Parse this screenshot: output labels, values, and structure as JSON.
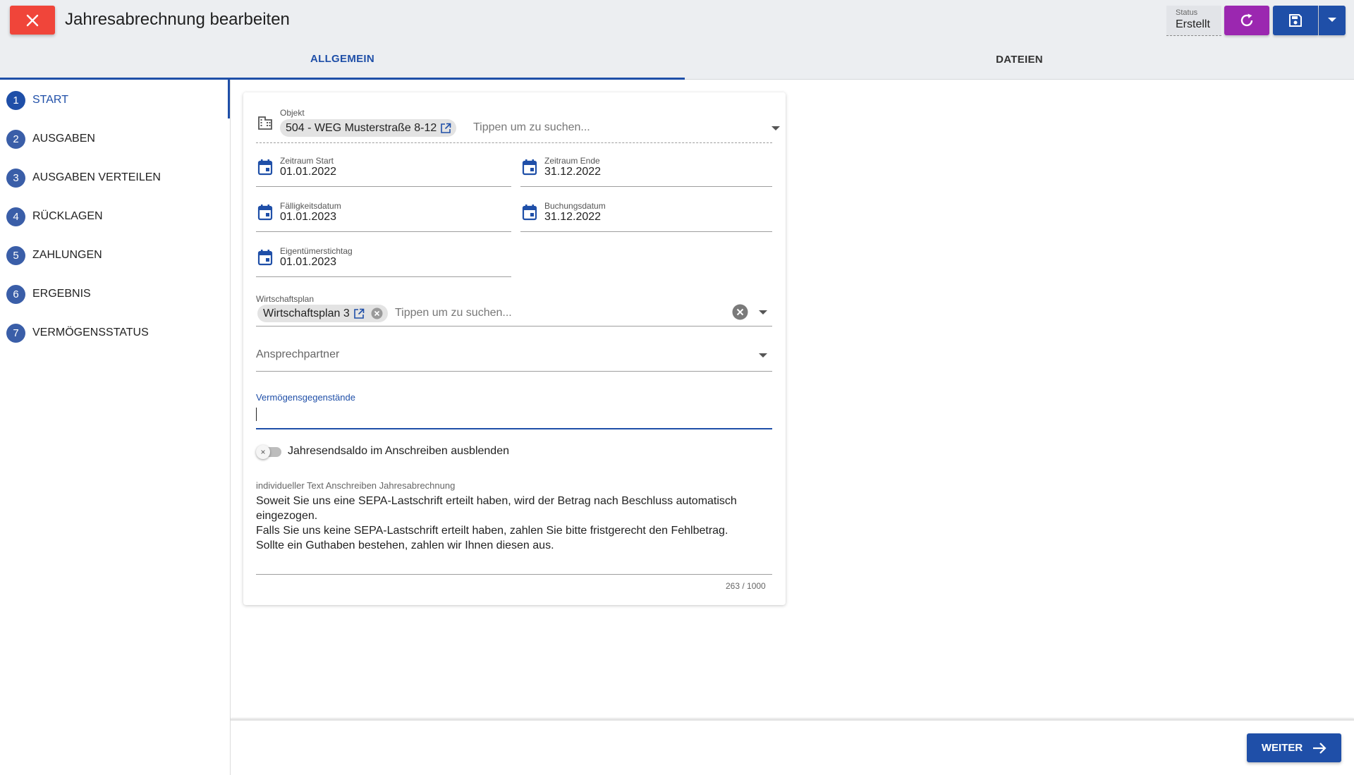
{
  "header": {
    "title": "Jahresabrechnung bearbeiten",
    "status_label": "Status",
    "status_value": "Erstellt"
  },
  "tabs": [
    {
      "label": "ALLGEMEIN",
      "active": true
    },
    {
      "label": "DATEIEN",
      "active": false
    }
  ],
  "sidebar": {
    "steps": [
      {
        "number": "1",
        "label": "START",
        "active": true
      },
      {
        "number": "2",
        "label": "AUSGABEN",
        "active": false
      },
      {
        "number": "3",
        "label": "AUSGABEN VERTEILEN",
        "active": false
      },
      {
        "number": "4",
        "label": "RÜCKLAGEN",
        "active": false
      },
      {
        "number": "5",
        "label": "ZAHLUNGEN",
        "active": false
      },
      {
        "number": "6",
        "label": "ERGEBNIS",
        "active": false
      },
      {
        "number": "7",
        "label": "VERMÖGENSSTATUS",
        "active": false
      }
    ]
  },
  "form": {
    "objekt": {
      "label": "Objekt",
      "chip": "504 - WEG Musterstraße 8-12",
      "placeholder": "Tippen um zu suchen..."
    },
    "zeitraum_start": {
      "label": "Zeitraum Start",
      "value": "01.01.2022"
    },
    "zeitraum_ende": {
      "label": "Zeitraum Ende",
      "value": "31.12.2022"
    },
    "faelligkeitsdatum": {
      "label": "Fälligkeitsdatum",
      "value": "01.01.2023"
    },
    "buchungsdatum": {
      "label": "Buchungsdatum",
      "value": "31.12.2022"
    },
    "eigentuemerstichtag": {
      "label": "Eigentümerstichtag",
      "value": "01.01.2023"
    },
    "wirtschaftsplan": {
      "label": "Wirtschaftsplan",
      "chip": "Wirtschaftsplan 3",
      "placeholder": "Tippen um zu suchen..."
    },
    "ansprechpartner": {
      "label": "Ansprechpartner",
      "value": ""
    },
    "vermoegensgegenstaende": {
      "label": "Vermögensgegenstände",
      "value": ""
    },
    "toggle": {
      "label": "Jahresendsaldo im Anschreiben ausblenden",
      "checked": false
    },
    "individueller_text": {
      "label": "individueller Text Anschreiben Jahresabrechnung",
      "lines": [
        "Soweit Sie uns eine SEPA-Lastschrift erteilt haben, wird der Betrag nach Beschluss automatisch",
        "eingezogen.",
        "Falls Sie uns keine SEPA-Lastschrift erteilt haben, zahlen Sie bitte fristgerecht den Fehlbetrag.",
        "Sollte ein Guthaben bestehen, zahlen wir Ihnen diesen aus."
      ],
      "counter": "263 / 1000"
    }
  },
  "footer": {
    "next_label": "WEITER"
  },
  "colors": {
    "primary": "#1f4fa8",
    "close": "#f0453a",
    "refresh": "#9b27b0",
    "header_bg": "#eceef1"
  },
  "icons": {
    "close": "close-icon",
    "refresh": "refresh-icon",
    "save": "save-icon",
    "building": "building-icon",
    "calendar": "calendar-icon",
    "external_link": "external-link-icon",
    "clear": "clear-icon",
    "arrow_right": "arrow-right-icon"
  }
}
